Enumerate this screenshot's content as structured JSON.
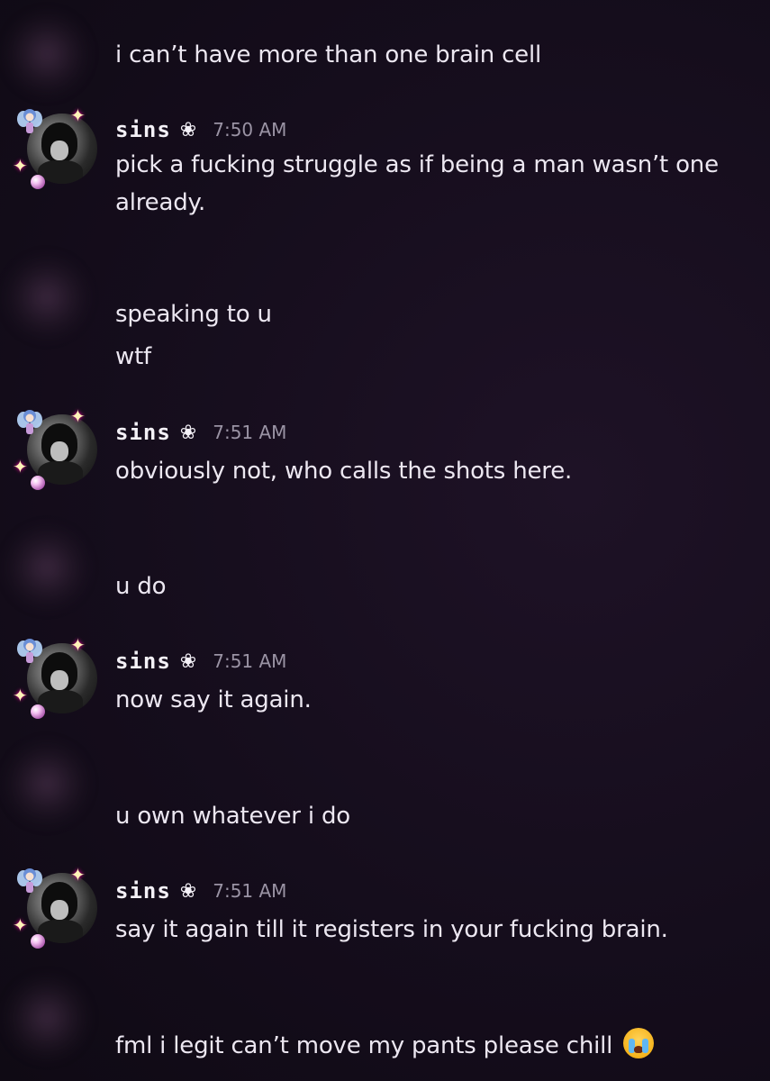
{
  "messages": {
    "m1": "i can’t have more than one brain cell",
    "g1": {
      "username": "sins",
      "badge": "❀",
      "time": "7:50 AM",
      "text": "pick a fucking struggle as if being a man wasn’t one already."
    },
    "m2a": "speaking to u",
    "m2b": "wtf",
    "g2": {
      "username": "sins",
      "badge": "❀",
      "time": "7:51 AM",
      "text": "obviously not, who calls the shots here."
    },
    "m3": "u do",
    "g3": {
      "username": "sins",
      "badge": "❀",
      "time": "7:51 AM",
      "text": "now say it again."
    },
    "m4": "u own whatever i do",
    "g4": {
      "username": "sins",
      "badge": "❀",
      "time": "7:51 AM",
      "text": "say it again till it registers in your fucking brain."
    },
    "m5": "fml i legit can’t move my pants please chill",
    "m5_emoji": "loudly-crying-face-emoji"
  },
  "icons": {
    "avatar": "sins-avatar",
    "fairy": "fairy-deco-icon",
    "star": "star-deco-icon",
    "bubble": "bubble-deco-icon"
  },
  "colors": {
    "background": "#150d1c",
    "text": "#ece7f1",
    "timestamp": "#9a93a4"
  }
}
